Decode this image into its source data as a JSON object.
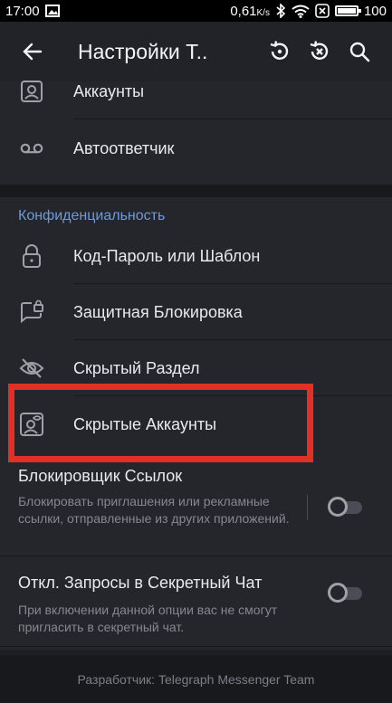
{
  "status_bar": {
    "time": "17:00",
    "speed": "0,61",
    "speed_unit": "K/s",
    "battery": "100",
    "icons": [
      "image-icon",
      "bluetooth-icon",
      "wifi-icon",
      "sim-icon"
    ]
  },
  "app_bar": {
    "title": "Настройки Т..",
    "icons": [
      "back-arrow-icon",
      "restore-icon",
      "reset-icon",
      "search-icon"
    ]
  },
  "accounts_section": {
    "items": [
      {
        "label": "Аккаунты",
        "icon": "accounts-icon"
      },
      {
        "label": "Автоответчик",
        "icon": "voicemail-icon"
      }
    ]
  },
  "privacy_section": {
    "header": "Конфиденциальность",
    "items": [
      {
        "label": "Код-Пароль или Шаблон",
        "icon": "lock-icon"
      },
      {
        "label": "Защитная Блокировка",
        "icon": "locked-chat-icon"
      },
      {
        "label": "Скрытый Раздел",
        "icon": "eye-off-icon"
      },
      {
        "label": "Скрытые Аккаунты",
        "icon": "hidden-account-icon"
      }
    ],
    "toggles": [
      {
        "title": "Блокировщик Ссылок",
        "description": "Блокировать приглашения или рекламные ссылки, отправленные из других приложений.",
        "enabled": false
      },
      {
        "title": "Откл. Запросы в Секретный Чат",
        "description": "При включении данной опции вас не смогут пригласить в секретный чат.",
        "enabled": false
      }
    ]
  },
  "footer": {
    "text": "Разработчик: Telegraph Messenger Team"
  },
  "colors": {
    "accent": "#6e9bd6",
    "highlight": "#e13127",
    "background": "#1d1f24"
  }
}
